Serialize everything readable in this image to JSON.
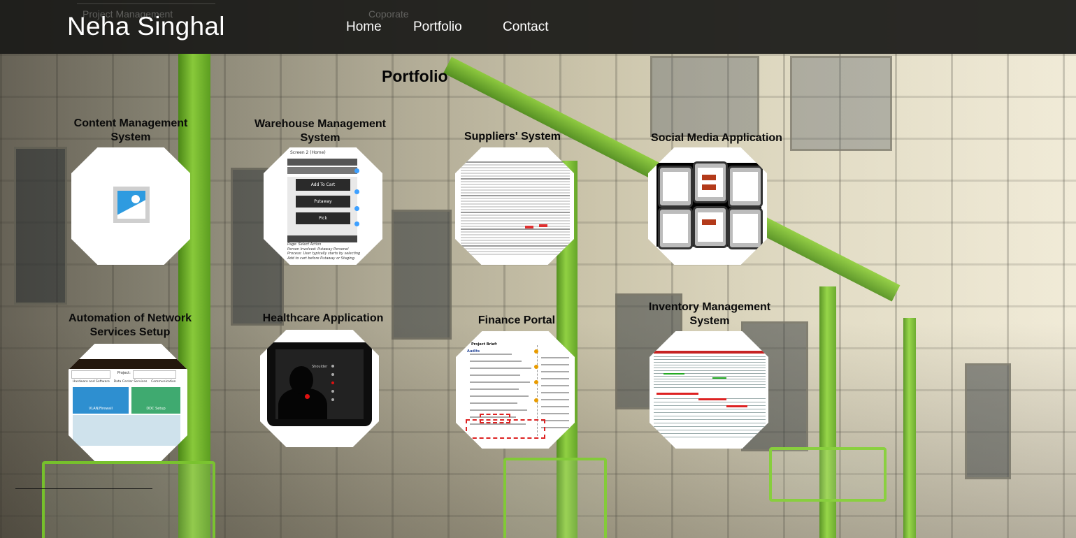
{
  "header": {
    "brand": "Neha Singhal",
    "tagline_left": "Project Management",
    "tagline_center": "Coporate",
    "nav": [
      {
        "label": "Home"
      },
      {
        "label": "Portfolio"
      },
      {
        "label": "Contact"
      }
    ]
  },
  "main": {
    "title": "Portfolio",
    "projects": [
      {
        "title": "Content Management System",
        "thumbnail": "image-placeholder-icon"
      },
      {
        "title": "Warehouse Management System",
        "thumbnail": "mobile-screen-mockup",
        "mock": {
          "screen_label": "Screen 2 (Home)",
          "buttons": [
            "Add To Cart",
            "Putaway",
            "Pick"
          ],
          "notes": [
            "Page: Select Action",
            "Person Involved: Putaway Personel",
            "Process: User typically starts by selecting Add to cart before Putaway or Staging."
          ]
        }
      },
      {
        "title": "Suppliers' System",
        "thumbnail": "data-table-screenshot"
      },
      {
        "title": "Social Media Application",
        "thumbnail": "phone-wireframes"
      },
      {
        "title": "Automation of Network Services Setup",
        "thumbnail": "network-dashboard",
        "mock": {
          "field_label": "Project:",
          "tiles": [
            "VLAN/Firewall",
            "DDC Setup"
          ],
          "tabs": [
            "Hardware and Software",
            "Data Center Services",
            "Communication"
          ]
        }
      },
      {
        "title": "Healthcare Application",
        "thumbnail": "tablet-body-map",
        "mock": {
          "label": "Shoulder"
        }
      },
      {
        "title": "Finance Portal",
        "thumbnail": "annotated-wireframe",
        "mock": {
          "heading": "Project Brief:",
          "sub": "Audits"
        }
      },
      {
        "title": "Inventory Management System",
        "thumbnail": "inventory-table-screenshot"
      }
    ]
  },
  "colors": {
    "accent_green": "#8fd63a",
    "header_bg": "#1a1a18"
  }
}
